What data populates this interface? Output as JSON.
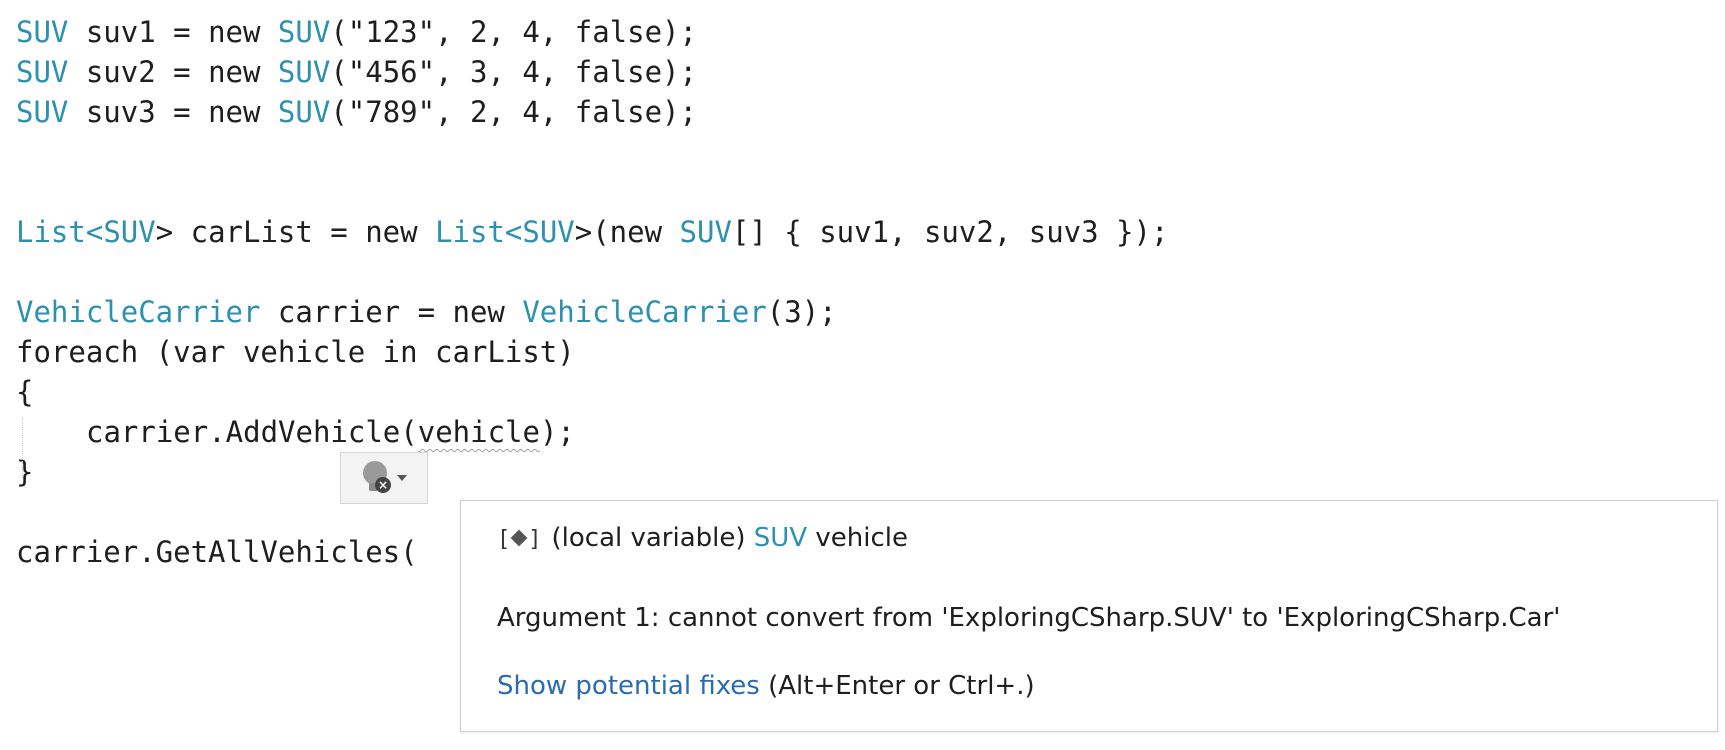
{
  "code": {
    "suv1": {
      "type": "SUV",
      "var": " suv1 = ",
      "kw": "new ",
      "ctor": "SUV",
      "args": "(\"123\", 2, 4, false);"
    },
    "suv2": {
      "type": "SUV",
      "var": " suv2 = ",
      "kw": "new ",
      "ctor": "SUV",
      "args": "(\"456\", 3, 4, false);"
    },
    "suv3": {
      "type": "SUV",
      "var": " suv3 = ",
      "kw": "new ",
      "ctor": "SUV",
      "args": "(\"789\", 2, 4, false);"
    },
    "list_line": {
      "t1": "List",
      "lt1": "<",
      "t2": "SUV",
      "gt1": "> carList = new ",
      "t3": "List",
      "lt2": "<",
      "t4": "SUV",
      "gt2": ">(new ",
      "t5": "SUV",
      "rest": "[] { suv1, suv2, suv3 });"
    },
    "carrier_line": {
      "t1": "VehicleCarrier",
      "mid": " carrier = new ",
      "t2": "VehicleCarrier",
      "rest": "(3);"
    },
    "foreach_line": "foreach (var vehicle in carList)",
    "open_brace": "{",
    "add_line": {
      "pre": "carrier.AddVehicle(",
      "arg": "vehicle",
      "post": ");"
    },
    "close_brace": "}",
    "getall_line": "carrier.GetAllVehicles("
  },
  "tooltip": {
    "symbol_prefix": "[",
    "symbol_suffix": "]",
    "signature_kind": "(local variable) ",
    "signature_type": "SUV",
    "signature_name": " vehicle",
    "error": "Argument 1: cannot convert from 'ExploringCSharp.SUV' to 'ExploringCSharp.Car'",
    "fix_link": "Show potential fixes",
    "fix_shortcut": " (Alt+Enter or Ctrl+.)"
  },
  "quick_action": {
    "icon": "lightbulb-error-icon",
    "error_glyph": "×"
  },
  "colors": {
    "type": "#2b91af",
    "text": "#1e1e1e",
    "link": "#2b6cb0"
  }
}
